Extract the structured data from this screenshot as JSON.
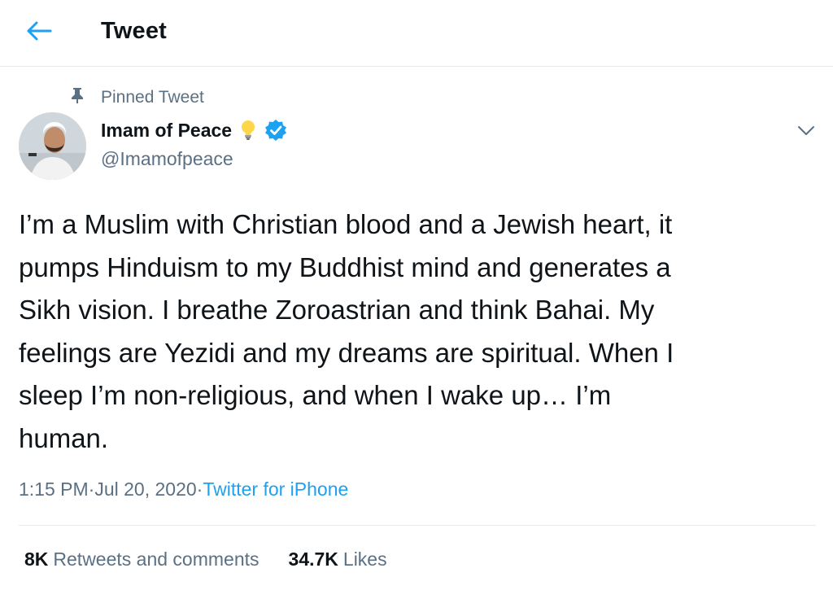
{
  "header": {
    "back_icon": "arrow-left-icon",
    "title": "Tweet"
  },
  "pinned": {
    "icon": "pin-icon",
    "label": "Pinned Tweet"
  },
  "author": {
    "display_name": "Imam of Peace",
    "emoji": "light-bulb-icon",
    "verified_icon": "verified-badge-icon",
    "handle": "@Imamofpeace"
  },
  "tweet": {
    "text": "I’m a Muslim with Christian blood and a Jewish heart, it\npumps Hinduism to my Buddhist mind and generates a\nSikh vision. I breathe Zoroastrian and think Bahai. My\nfeelings are Yezidi and my dreams are spiritual. When I\nsleep I’m non-religious, and when I wake up… I’m\nhuman.",
    "time": "1:15 PM",
    "sep1": " · ",
    "date": "Jul 20, 2020",
    "sep2": " · ",
    "source": "Twitter for iPhone"
  },
  "stats": {
    "retweets_count": "8K",
    "retweets_label": "Retweets and comments",
    "likes_count": "34.7K",
    "likes_label": "Likes"
  },
  "colors": {
    "accent": "#1da1f2",
    "secondary_text": "#5b7083",
    "primary_text": "#0f1419",
    "divider": "#e6ecf0"
  }
}
